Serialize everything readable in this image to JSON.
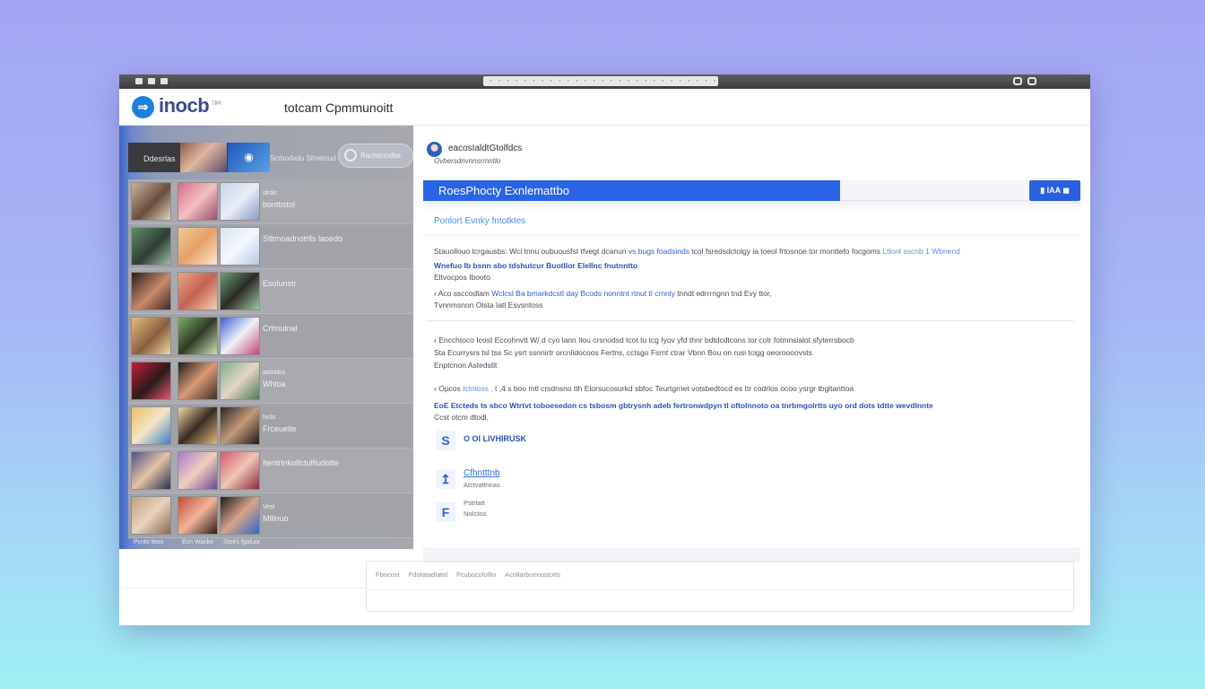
{
  "browser": {
    "url": "· · · · · · · · · · · · · · · · · · · · · · · · · · · · · · · · · ·"
  },
  "header": {
    "logo_symbol": "⇒",
    "logo_text": "inocb",
    "logo_sub": "ᵀᴵᴾᴵ",
    "app_title": "totcam Cpmmunoitt"
  },
  "leftpanel": {
    "video_label": "Ddesrlas",
    "video_caption": "Scrbodvdu Sfrretoud",
    "pill_label": "Rachsnndbe",
    "rows": [
      {
        "small": "slrolc",
        "big": "bonttistol"
      },
      {
        "small": "",
        "big": "Stltmoadnotrlls laoedo"
      },
      {
        "small": "",
        "big": "Esolunstr"
      },
      {
        "small": "",
        "big": "Crtmulnal"
      },
      {
        "small": "aslsldos",
        "big": "Whloa"
      },
      {
        "small": "fvcls",
        "big": "Frceuelte"
      },
      {
        "small": "",
        "big": "Itentrlnkolfctulfiudotte"
      },
      {
        "small": "Vesl",
        "big": "Mlllnuo"
      }
    ],
    "row_footer": [
      "Pcnto teuo",
      "Ecn Wacke",
      "Stoirs fgaluor"
    ]
  },
  "main": {
    "profile_name": "eacosIaldtGtolfdcs",
    "profile_sub": "Ovbersdnvnnsrrnntlo",
    "bar_title": "RoesPhocty Exnlemattbo",
    "top_button": "▮ IAA ◼",
    "section_link": "Ponlort Evnky fntotktes",
    "block1": [
      {
        "text": "Stauollouo tcrgausbs: Wcl tnnu oubuousfst tfvegt dcanun",
        "blue": " vs bugs foadsinds",
        "rest": " tcol fsredsdctolgy ia toeol frtosnoe tor monttefo focgoms",
        "lblue": "   Ltlont sscnb",
        "tail": "       1 Wbnend"
      },
      {
        "strong": "Wnefuo Ib bsnn sbo tdshutcur Buotllor Elellnc fnutnntto"
      },
      {
        "text": "Eltvocpos Ibooto"
      },
      {
        "mark": "‹",
        "text": " Aco ssccodlam ",
        "blue": "Wclcsl Ba bmarkdcstl day Bcods nonntnt rtnut tl crnnly",
        "rest": " tnndt edrrrngnn tnd Evy ttor,"
      },
      {
        "text": "  Tvnnmsnon Olsta Iatl Esvsntoss"
      }
    ],
    "block2": [
      {
        "mark": "‹",
        "text": " Encchtoco Icost Eccohnvtt W/ d cyo lann  Ilou crsnodsd tcot tu tcg Iyov yfd thnr bdtdcdtcons tor cotr fotmnsialot sfyterrsbocb"
      },
      {
        "text": "Sta Ecurrysrs tsl tss Sc ysrt ssnnirtr orcnlidocoos Fertns, cctsgo Fsrnt ctrar Vbnn  Bou on rusi tcigg oeoroooovsts"
      },
      {
        "text": "Enptcnon Astedstlt"
      },
      {
        "mark": "‹",
        "text": " Opcos",
        "lblue": "  Ictnloss ,",
        "rest": " t ,4 s boo mtl crsdnsno tth Elorsucosurkd sbfoc Teurtgrnet votsbedtocd es ttr codrlos ocoo ysrgr tbgltanttoa"
      },
      {
        "strong": "EoE Etcteds ts sbco Wtrtvt toboesedon cs tsbosm gbtrysnh adeb fertronwdpyn tl oftolnnoto oa tnrbmgolrtts uyo ord dots tdtte wevdlnnte"
      },
      {
        "text": "Ccst otcm dtodl,"
      }
    ],
    "actions": [
      {
        "icon": "S",
        "label": "O Ol LIVHIRUSK",
        "sub": ""
      },
      {
        "icon": "↥",
        "label": "Cfhntttnb",
        "sub": "Atctvattncas"
      },
      {
        "icon": "F",
        "label": "Pstrtatt",
        "sub": "NoIctos"
      }
    ]
  },
  "footer": {
    "links": [
      "Fbncost",
      "Fdotatadlatnl",
      "Fcubucolollto",
      "Acollarbonnostotts"
    ]
  },
  "colors": {
    "accent": "#2964e6",
    "link": "#4a8ae0",
    "titlebar": "#4a4a4c"
  },
  "icons": {
    "window_controls_left": [
      "folder-icon",
      "tab-icon",
      "tab-icon"
    ],
    "window_controls_right": [
      "camera-icon",
      "share-icon"
    ],
    "pill": "refresh-icon"
  }
}
